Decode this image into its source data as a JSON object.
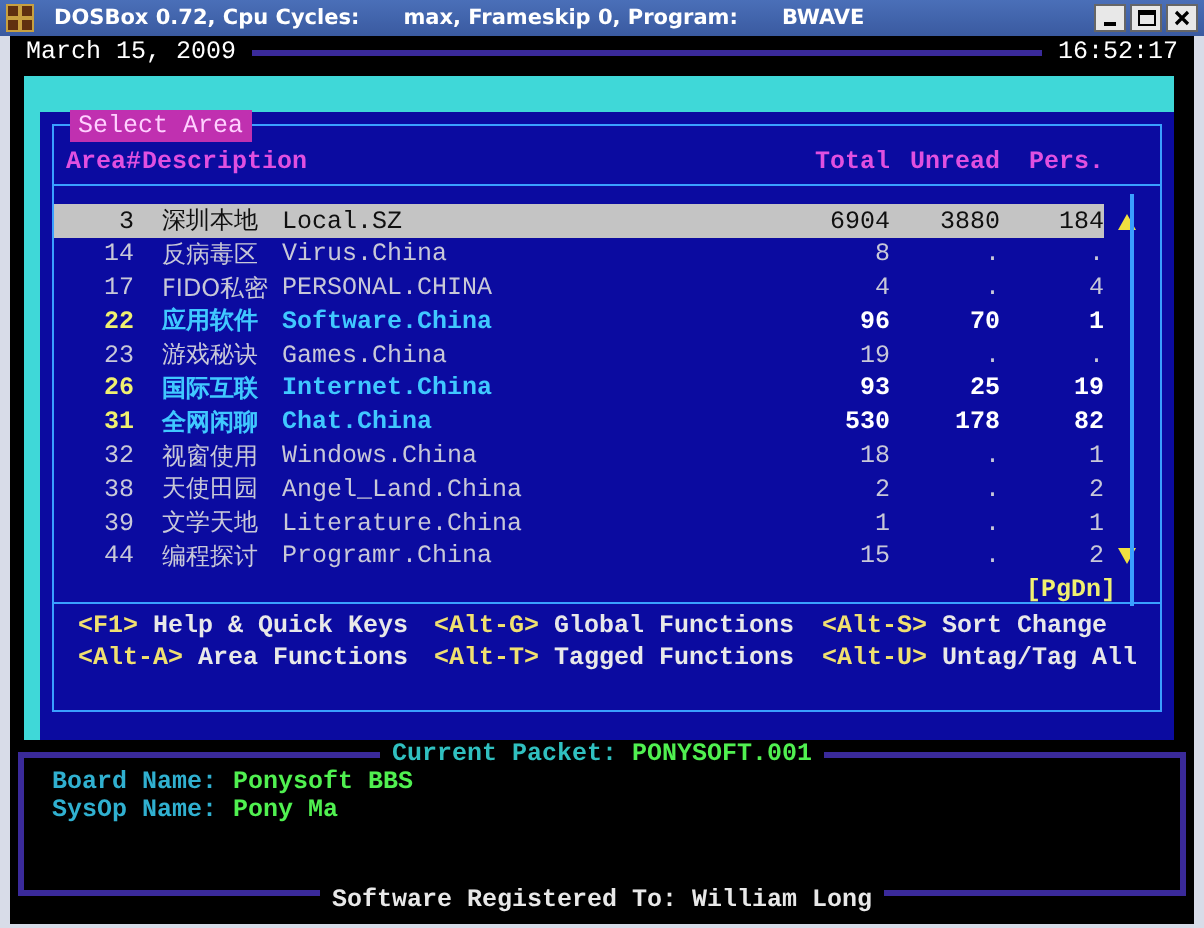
{
  "window": {
    "title_parts": [
      "DOSBox 0.72, Cpu Cycles:",
      "max, Frameskip  0, Program:",
      "BWAVE"
    ]
  },
  "header": {
    "date": "March 15, 2009",
    "time": "16:52:17"
  },
  "panel": {
    "title": "Select Area",
    "columns": [
      "Area#",
      "Description",
      "Total",
      "Unread",
      "Pers."
    ],
    "rows": [
      {
        "area": "3",
        "chinese": "深圳本地",
        "name": "Local.SZ",
        "total": "6904",
        "unread": "3880",
        "pers": "184",
        "selected": true,
        "new": false
      },
      {
        "area": "14",
        "chinese": "反病毒区",
        "name": "Virus.China",
        "total": "8",
        "unread": ".",
        "pers": ".",
        "selected": false,
        "new": false
      },
      {
        "area": "17",
        "chinese": "FIDO私密",
        "name": "PERSONAL.CHINA",
        "total": "4",
        "unread": ".",
        "pers": "4",
        "selected": false,
        "new": false
      },
      {
        "area": "22",
        "chinese": "应用软件",
        "name": "Software.China",
        "total": "96",
        "unread": "70",
        "pers": "1",
        "selected": false,
        "new": true
      },
      {
        "area": "23",
        "chinese": "游戏秘诀",
        "name": "Games.China",
        "total": "19",
        "unread": ".",
        "pers": ".",
        "selected": false,
        "new": false
      },
      {
        "area": "26",
        "chinese": "国际互联",
        "name": "Internet.China",
        "total": "93",
        "unread": "25",
        "pers": "19",
        "selected": false,
        "new": true
      },
      {
        "area": "31",
        "chinese": "全网闲聊",
        "name": "Chat.China",
        "total": "530",
        "unread": "178",
        "pers": "82",
        "selected": false,
        "new": true
      },
      {
        "area": "32",
        "chinese": "视窗使用",
        "name": "Windows.China",
        "total": "18",
        "unread": ".",
        "pers": "1",
        "selected": false,
        "new": false
      },
      {
        "area": "38",
        "chinese": "天使田园",
        "name": "Angel_Land.China",
        "total": "2",
        "unread": ".",
        "pers": "2",
        "selected": false,
        "new": false
      },
      {
        "area": "39",
        "chinese": "文学天地",
        "name": "Literature.China",
        "total": "1",
        "unread": ".",
        "pers": "1",
        "selected": false,
        "new": false
      },
      {
        "area": "44",
        "chinese": "编程探讨",
        "name": "Programr.China",
        "total": "15",
        "unread": ".",
        "pers": "2",
        "selected": false,
        "new": false
      }
    ],
    "page_hint": "[PgDn]",
    "keys": [
      {
        "key": "<F1>",
        "label": "Help & Quick Keys"
      },
      {
        "key": "<Alt-G>",
        "label": "Global Functions"
      },
      {
        "key": "<Alt-S>",
        "label": "Sort Change"
      },
      {
        "key": "<Alt-A>",
        "label": "Area Functions"
      },
      {
        "key": "<Alt-T>",
        "label": "Tagged Functions"
      },
      {
        "key": "<Alt-U>",
        "label": "Untag/Tag All"
      }
    ]
  },
  "packet": {
    "label": "Current Packet:",
    "value": "PONYSOFT.001",
    "fields": [
      {
        "label": "Board Name:",
        "value": "Ponysoft BBS"
      },
      {
        "label": "SysOp Name:",
        "value": "Pony Ma"
      }
    ]
  },
  "registration": "Software Registered To: William Long"
}
